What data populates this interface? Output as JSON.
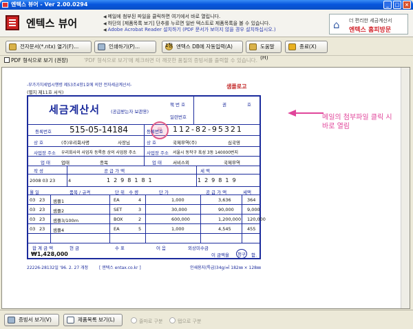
{
  "window": {
    "title": "엔텍스 뷰어 - Ver 2.00.0294"
  },
  "header": {
    "app_title": "엔텍스 뷰어",
    "notices": [
      "메일에 첨부된 파일을 클릭하면 여기에서 바로 열립니다.",
      "하단의 [제품목록 보기] 단추를 누르면 일반 텍스트로 제품목록을 볼 수 있습니다.",
      "Adobe Acrobat Reader 설치하기 (PDF 문서가 보이지 않을 경우 설치하십시오.)"
    ],
    "home": {
      "line1": "더 편리한 세금계산서",
      "line2": "엔텍스 홈피방문"
    }
  },
  "toolbar": {
    "open_label": "전자문서(*.ntx) 열기(F)...",
    "print_label": "인쇄하기(P)...",
    "page_label": "1장",
    "db_label": "엔텍스 DB에 자동입력(A)",
    "help_label": "도움말(H)",
    "exit_label": "종료(X)"
  },
  "subbar": {
    "pdf_check_label": "PDF 형식으로 보기 (권장)",
    "hint": "'PDF 형식으로 보기'에 체크하면 더 깨끗한 품질의 증빙서를 출력할 수 있습니다."
  },
  "invoice": {
    "law": "-부가가치세법시행령 제53조4항1호에 의한 전자세금계산서-",
    "form": "(별지 제11호 서식)",
    "sample_logo": "샘플로고",
    "title": "세금계산서",
    "title_sub": "(공급받는자 보관용)",
    "book_no": "책 번 호",
    "kwon": "권",
    "ho": "호",
    "serial": "일련번호",
    "supplier_reg": "515-05-14184",
    "supplier_name": "(주)우리회사명",
    "supplier_ceo": "사장님",
    "supplier_addr": "우리회사의 사업자 등록증 상의 사업장 주소",
    "supplier_type": "업태",
    "supplier_item": "종목",
    "buyer_reg": "112-82-95321",
    "buyer_name": "국제무역(주)",
    "buyer_ceo": "심국영",
    "buyer_addr": "서울시 동작구 흑성 3동 140000번지",
    "buyer_type": "서비스외",
    "buyer_item": "국제무역",
    "date": "2008 03 23",
    "blank_count": "4",
    "supply_amount": "1298181",
    "tax_amount": "129819",
    "items": [
      {
        "m": "03",
        "d": "23",
        "name": "샘플1",
        "unit": "EA",
        "qty": "4",
        "price": "1,000",
        "supply": "3,636",
        "tax": "364"
      },
      {
        "m": "03",
        "d": "23",
        "name": "샘플2",
        "unit": "SET",
        "qty": "3",
        "price": "30,000",
        "supply": "90,000",
        "tax": "9,000"
      },
      {
        "m": "03",
        "d": "23",
        "name": "샘플3/100m",
        "unit": "BOX",
        "qty": "2",
        "price": "600,000",
        "supply": "1,200,000",
        "tax": "120,000"
      },
      {
        "m": "03",
        "d": "23",
        "name": "샘플4",
        "unit": "EA",
        "qty": "5",
        "price": "1,000",
        "supply": "4,545",
        "tax": "455"
      }
    ],
    "total": "₩1,428,000",
    "total_labels": [
      "합 계 금 액",
      "현 금",
      "수 표",
      "어 음",
      "외상미수금"
    ],
    "receipt_text": "이 금액을",
    "receipt_stamp": "청구",
    "receipt_end": "함.",
    "footer_left": "22226-28132일 '96. 2. 27 개정",
    "footer_mid": "[ 엔텍스 entax.co.kr ]",
    "footer_right": "인쇄용지(특급)34g/㎡ 182㎜ × 128㎜"
  },
  "callout": {
    "line1": "메일의 첨부파일 클릭 시",
    "line2": "바로 열림"
  },
  "bottom": {
    "voucher_label": "증빙서 보기(V)",
    "product_label": "제품목록 보기(L)",
    "radio1": "줄마로 구분",
    "radio2": "탭으로 구분"
  },
  "colors": {
    "title_blue": "#0856dd",
    "form_blue": "#1a2a9c",
    "accent_pink": "#e0459a"
  }
}
